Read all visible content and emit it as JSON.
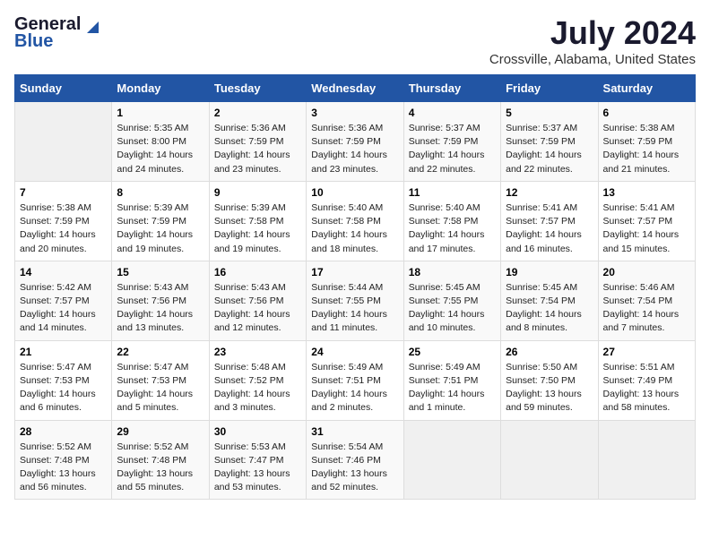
{
  "logo": {
    "general": "General",
    "blue": "Blue"
  },
  "title": "July 2024",
  "location": "Crossville, Alabama, United States",
  "days_header": [
    "Sunday",
    "Monday",
    "Tuesday",
    "Wednesday",
    "Thursday",
    "Friday",
    "Saturday"
  ],
  "weeks": [
    [
      {
        "num": "",
        "info": ""
      },
      {
        "num": "1",
        "info": "Sunrise: 5:35 AM\nSunset: 8:00 PM\nDaylight: 14 hours\nand 24 minutes."
      },
      {
        "num": "2",
        "info": "Sunrise: 5:36 AM\nSunset: 7:59 PM\nDaylight: 14 hours\nand 23 minutes."
      },
      {
        "num": "3",
        "info": "Sunrise: 5:36 AM\nSunset: 7:59 PM\nDaylight: 14 hours\nand 23 minutes."
      },
      {
        "num": "4",
        "info": "Sunrise: 5:37 AM\nSunset: 7:59 PM\nDaylight: 14 hours\nand 22 minutes."
      },
      {
        "num": "5",
        "info": "Sunrise: 5:37 AM\nSunset: 7:59 PM\nDaylight: 14 hours\nand 22 minutes."
      },
      {
        "num": "6",
        "info": "Sunrise: 5:38 AM\nSunset: 7:59 PM\nDaylight: 14 hours\nand 21 minutes."
      }
    ],
    [
      {
        "num": "7",
        "info": "Sunrise: 5:38 AM\nSunset: 7:59 PM\nDaylight: 14 hours\nand 20 minutes."
      },
      {
        "num": "8",
        "info": "Sunrise: 5:39 AM\nSunset: 7:59 PM\nDaylight: 14 hours\nand 19 minutes."
      },
      {
        "num": "9",
        "info": "Sunrise: 5:39 AM\nSunset: 7:58 PM\nDaylight: 14 hours\nand 19 minutes."
      },
      {
        "num": "10",
        "info": "Sunrise: 5:40 AM\nSunset: 7:58 PM\nDaylight: 14 hours\nand 18 minutes."
      },
      {
        "num": "11",
        "info": "Sunrise: 5:40 AM\nSunset: 7:58 PM\nDaylight: 14 hours\nand 17 minutes."
      },
      {
        "num": "12",
        "info": "Sunrise: 5:41 AM\nSunset: 7:57 PM\nDaylight: 14 hours\nand 16 minutes."
      },
      {
        "num": "13",
        "info": "Sunrise: 5:41 AM\nSunset: 7:57 PM\nDaylight: 14 hours\nand 15 minutes."
      }
    ],
    [
      {
        "num": "14",
        "info": "Sunrise: 5:42 AM\nSunset: 7:57 PM\nDaylight: 14 hours\nand 14 minutes."
      },
      {
        "num": "15",
        "info": "Sunrise: 5:43 AM\nSunset: 7:56 PM\nDaylight: 14 hours\nand 13 minutes."
      },
      {
        "num": "16",
        "info": "Sunrise: 5:43 AM\nSunset: 7:56 PM\nDaylight: 14 hours\nand 12 minutes."
      },
      {
        "num": "17",
        "info": "Sunrise: 5:44 AM\nSunset: 7:55 PM\nDaylight: 14 hours\nand 11 minutes."
      },
      {
        "num": "18",
        "info": "Sunrise: 5:45 AM\nSunset: 7:55 PM\nDaylight: 14 hours\nand 10 minutes."
      },
      {
        "num": "19",
        "info": "Sunrise: 5:45 AM\nSunset: 7:54 PM\nDaylight: 14 hours\nand 8 minutes."
      },
      {
        "num": "20",
        "info": "Sunrise: 5:46 AM\nSunset: 7:54 PM\nDaylight: 14 hours\nand 7 minutes."
      }
    ],
    [
      {
        "num": "21",
        "info": "Sunrise: 5:47 AM\nSunset: 7:53 PM\nDaylight: 14 hours\nand 6 minutes."
      },
      {
        "num": "22",
        "info": "Sunrise: 5:47 AM\nSunset: 7:53 PM\nDaylight: 14 hours\nand 5 minutes."
      },
      {
        "num": "23",
        "info": "Sunrise: 5:48 AM\nSunset: 7:52 PM\nDaylight: 14 hours\nand 3 minutes."
      },
      {
        "num": "24",
        "info": "Sunrise: 5:49 AM\nSunset: 7:51 PM\nDaylight: 14 hours\nand 2 minutes."
      },
      {
        "num": "25",
        "info": "Sunrise: 5:49 AM\nSunset: 7:51 PM\nDaylight: 14 hours\nand 1 minute."
      },
      {
        "num": "26",
        "info": "Sunrise: 5:50 AM\nSunset: 7:50 PM\nDaylight: 13 hours\nand 59 minutes."
      },
      {
        "num": "27",
        "info": "Sunrise: 5:51 AM\nSunset: 7:49 PM\nDaylight: 13 hours\nand 58 minutes."
      }
    ],
    [
      {
        "num": "28",
        "info": "Sunrise: 5:52 AM\nSunset: 7:48 PM\nDaylight: 13 hours\nand 56 minutes."
      },
      {
        "num": "29",
        "info": "Sunrise: 5:52 AM\nSunset: 7:48 PM\nDaylight: 13 hours\nand 55 minutes."
      },
      {
        "num": "30",
        "info": "Sunrise: 5:53 AM\nSunset: 7:47 PM\nDaylight: 13 hours\nand 53 minutes."
      },
      {
        "num": "31",
        "info": "Sunrise: 5:54 AM\nSunset: 7:46 PM\nDaylight: 13 hours\nand 52 minutes."
      },
      {
        "num": "",
        "info": ""
      },
      {
        "num": "",
        "info": ""
      },
      {
        "num": "",
        "info": ""
      }
    ]
  ]
}
